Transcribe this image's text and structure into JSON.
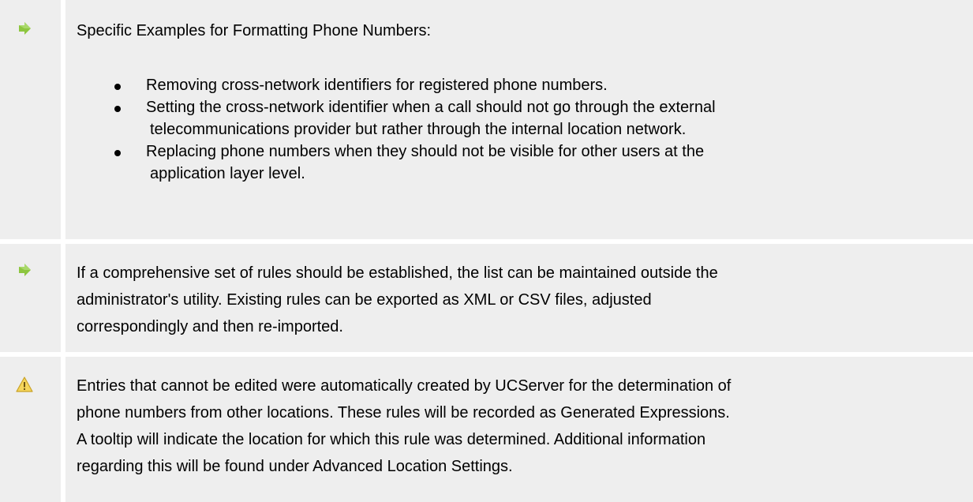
{
  "notes": [
    {
      "icon": "green-arrow-icon",
      "heading": "Specific Examples for Formatting Phone Numbers:",
      "bullets": [
        {
          "line1": "Removing cross-network identifiers for registered phone numbers.",
          "line2": ""
        },
        {
          "line1": "Setting the cross-network identifier when a call should not go through the external",
          "line2": "telecommunications provider but rather through the internal location network."
        },
        {
          "line1": "Replacing phone numbers when they should not be visible for other users at the",
          "line2": "application layer level."
        }
      ]
    },
    {
      "icon": "green-arrow-icon",
      "lines": [
        "If a comprehensive set of rules should be established, the list can be maintained outside the",
        "administrator's utility. Existing rules can be exported as XML or CSV files, adjusted",
        "correspondingly and then re-imported."
      ]
    },
    {
      "icon": "warning-icon",
      "lines": [
        "Entries that cannot be edited were automatically created by UCServer for the determination of",
        "phone numbers from other locations. These rules will be recorded as Generated Expressions.",
        "A tooltip will indicate the location for which this rule was determined. Additional information",
        "regarding this will be found under Advanced Location Settings."
      ]
    }
  ],
  "colors": {
    "note_background": "#eeeeee",
    "arrow_green": "#8dc63f",
    "warning_yellow": "#f5d55a"
  }
}
